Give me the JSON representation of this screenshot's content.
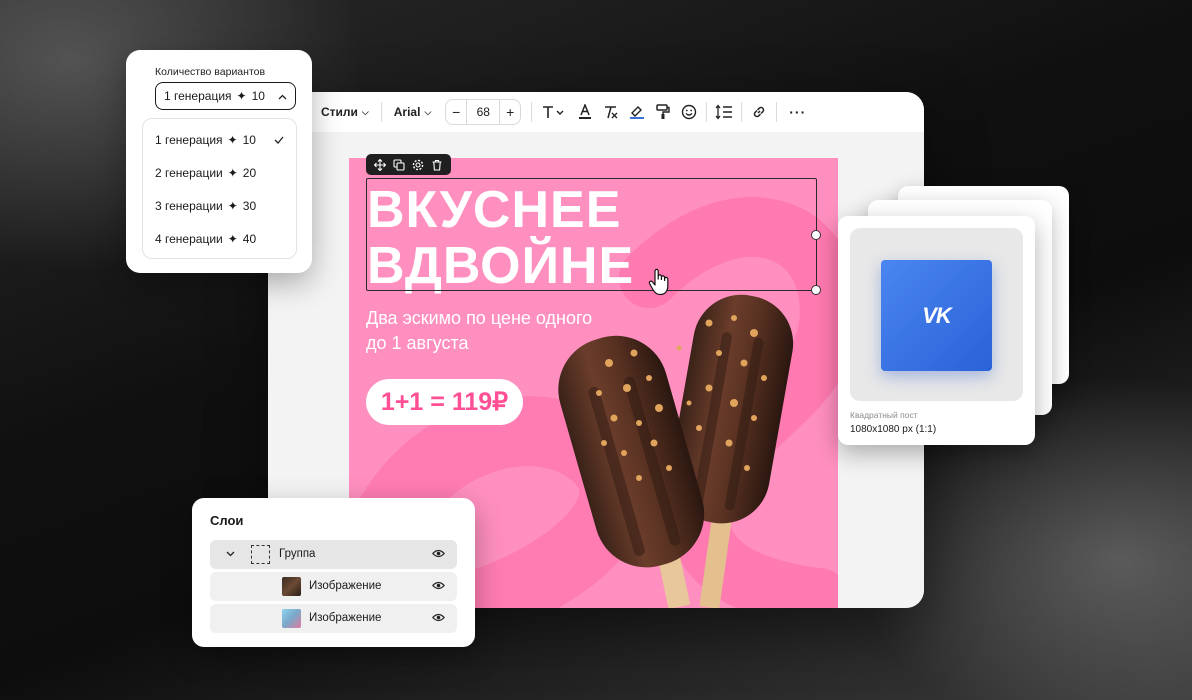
{
  "toolbar": {
    "styles_label": "Стили",
    "font_label": "Arial",
    "font_size": "68",
    "minus": "−",
    "plus": "+",
    "more": "···"
  },
  "banner": {
    "headline_line1": "ВКУСНЕЕ",
    "headline_line2": "ВДВОЙНЕ",
    "subline_line1": "Два эскимо по цене одного",
    "subline_line2": "до 1 августа",
    "price": "1+1 = 119₽",
    "background_color": "#ff8fbf",
    "accent_color": "#ff4f95"
  },
  "variants": {
    "label": "Количество вариантов",
    "selected": "1 генерация",
    "selected_count": "10",
    "options": [
      {
        "label": "1 генерация",
        "count": "10",
        "checked": true
      },
      {
        "label": "2 генерации",
        "count": "20",
        "checked": false
      },
      {
        "label": "3 генерации",
        "count": "30",
        "checked": false
      },
      {
        "label": "4 генерации",
        "count": "40",
        "checked": false
      }
    ]
  },
  "format_card": {
    "caption": "Квадратный пост",
    "size": "1080x1080 px (1:1)",
    "logo": "VK"
  },
  "layers": {
    "title": "Слои",
    "rows": [
      {
        "label": "Группа",
        "icon": "group-icon"
      },
      {
        "label": "Изображение",
        "icon": "image-thumbnail"
      },
      {
        "label": "Изображение",
        "icon": "image-thumbnail"
      }
    ]
  }
}
